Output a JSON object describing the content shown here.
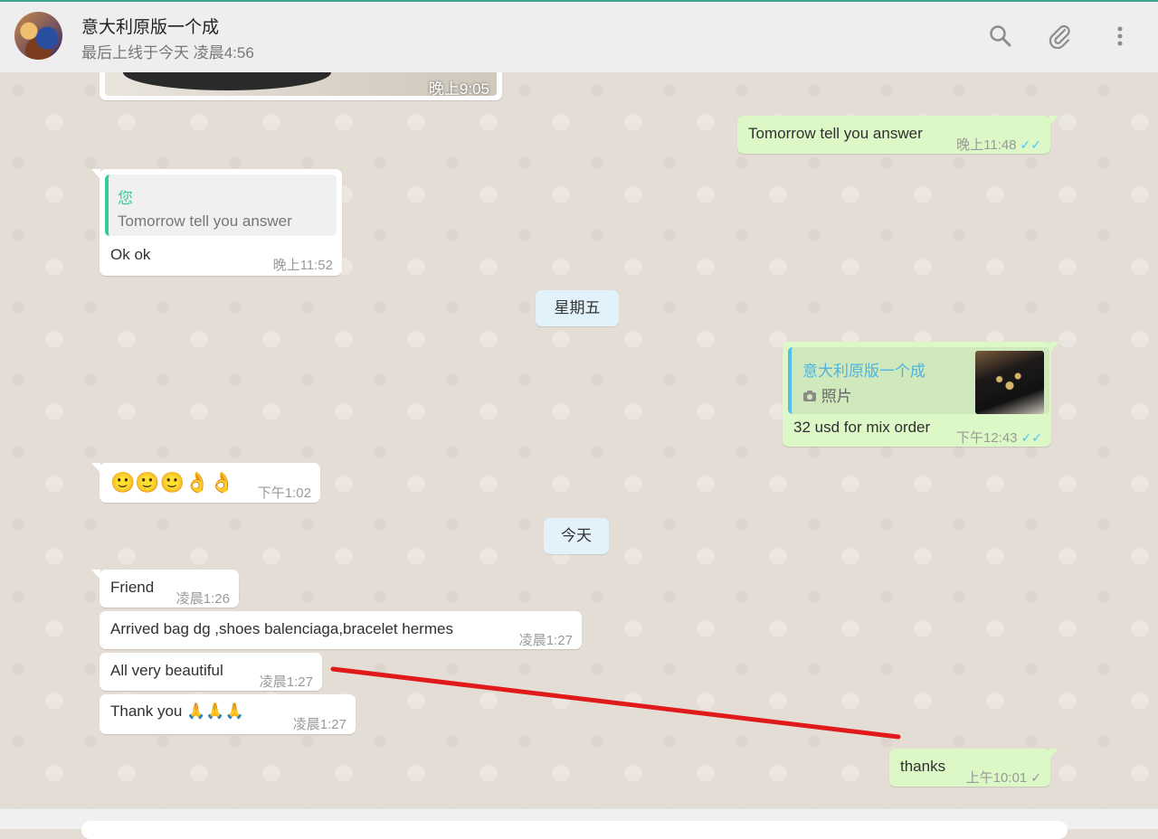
{
  "header": {
    "contact_name": "意大利原版一个成",
    "last_seen": "最后上线于今天 凌晨4:56"
  },
  "image_message": {
    "time": "晚上9:05"
  },
  "messages": [
    {
      "dir": "out",
      "text": "Tomorrow tell you answer",
      "time": "晚上11:48",
      "ticks": "✓✓"
    },
    {
      "dir": "in",
      "quote_author": "您",
      "quote_text": "Tomorrow tell you answer",
      "text": "Ok ok",
      "time": "晚上11:52"
    },
    {
      "dir": "out",
      "quote_author": "意大利原版一个成",
      "quote_text": "照片",
      "text": "32 usd for mix order",
      "time": "下午12:43",
      "ticks": "✓✓"
    },
    {
      "dir": "in",
      "text": "🙂🙂🙂👌👌",
      "time": "下午1:02"
    },
    {
      "dir": "in",
      "text": "Friend",
      "time": "凌晨1:26"
    },
    {
      "dir": "in",
      "text": "Arrived bag dg ,shoes balenciaga,bracelet hermes",
      "time": "凌晨1:27"
    },
    {
      "dir": "in",
      "text": "All very beautiful",
      "time": "凌晨1:27"
    },
    {
      "dir": "in",
      "text": "Thank you 🙏🙏🙏",
      "time": "凌晨1:27"
    },
    {
      "dir": "out",
      "text": "thanks",
      "time": "上午10:01",
      "ticks": "✓"
    }
  ],
  "day_dividers": [
    "星期五",
    "今天"
  ],
  "icons": {
    "search": "search-icon",
    "attach": "paperclip-icon",
    "menu": "more-vertical-icon",
    "photo": "camera-icon"
  },
  "colors": {
    "incoming": "#ffffff",
    "outgoing": "#dcf8c6",
    "day_chip": "#e1f2fb",
    "read_ticks": "#4fc3f7",
    "annotation_line": "#e01a1a"
  }
}
